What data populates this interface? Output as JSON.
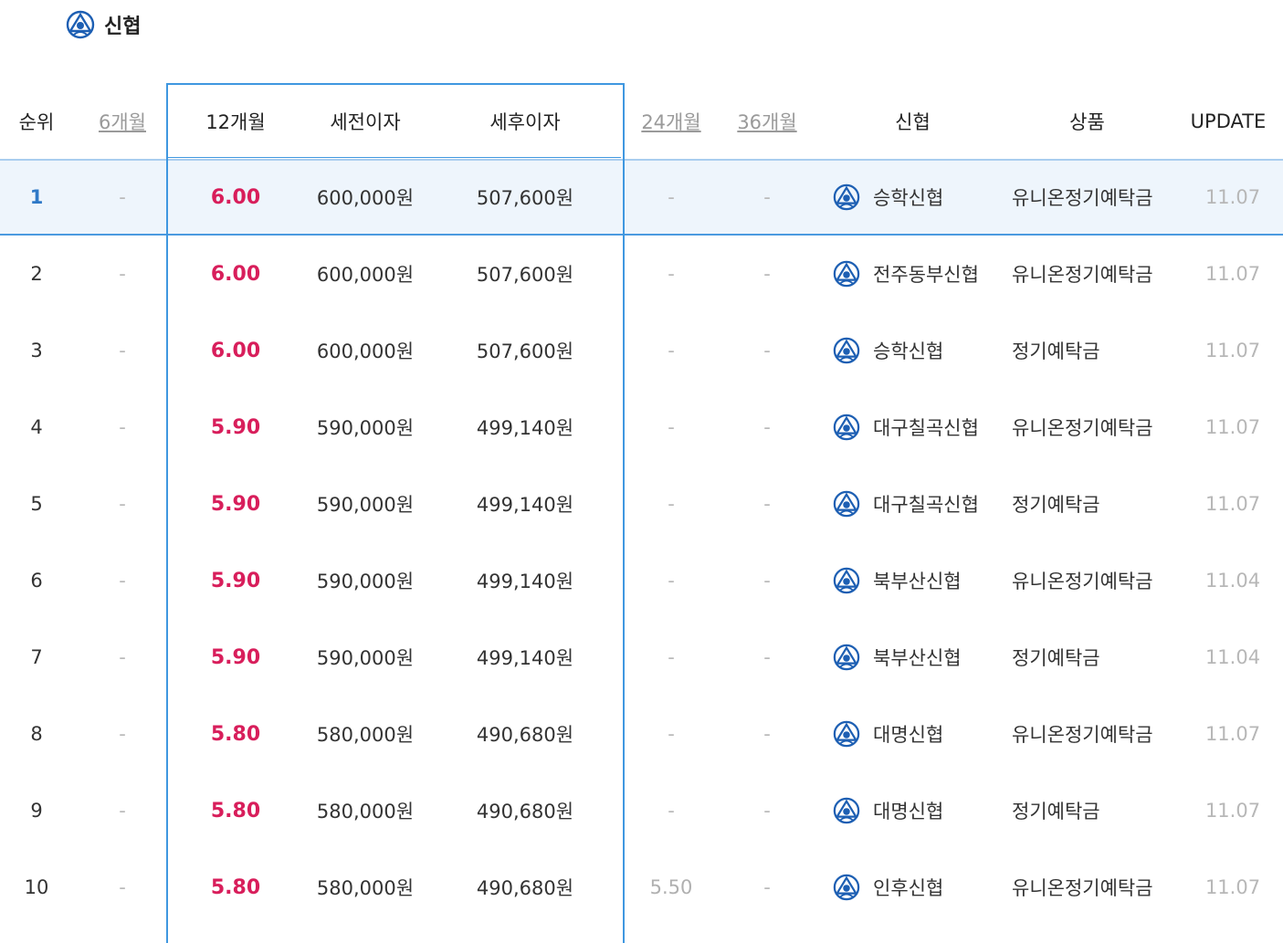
{
  "header": {
    "title": "신협",
    "logo_icon": "cu-logo-icon"
  },
  "columns": {
    "rank": "순위",
    "m6": "6개월",
    "m12": "12개월",
    "pre_tax": "세전이자",
    "post_tax": "세후이자",
    "m24": "24개월",
    "m36": "36개월",
    "bank": "신협",
    "product": "상품",
    "update": "UPDATE"
  },
  "colors": {
    "accent": "#3f97e0",
    "rate": "#d81e5b"
  },
  "rows": [
    {
      "rank": "1",
      "m6": "-",
      "m12": "6.00",
      "pre_tax": "600,000원",
      "post_tax": "507,600원",
      "m24": "-",
      "m36": "-",
      "bank": "승학신협",
      "product": "유니온정기예탁금",
      "update": "11.07"
    },
    {
      "rank": "2",
      "m6": "-",
      "m12": "6.00",
      "pre_tax": "600,000원",
      "post_tax": "507,600원",
      "m24": "-",
      "m36": "-",
      "bank": "전주동부신협",
      "product": "유니온정기예탁금",
      "update": "11.07"
    },
    {
      "rank": "3",
      "m6": "-",
      "m12": "6.00",
      "pre_tax": "600,000원",
      "post_tax": "507,600원",
      "m24": "-",
      "m36": "-",
      "bank": "승학신협",
      "product": "정기예탁금",
      "update": "11.07"
    },
    {
      "rank": "4",
      "m6": "-",
      "m12": "5.90",
      "pre_tax": "590,000원",
      "post_tax": "499,140원",
      "m24": "-",
      "m36": "-",
      "bank": "대구칠곡신협",
      "product": "유니온정기예탁금",
      "update": "11.07"
    },
    {
      "rank": "5",
      "m6": "-",
      "m12": "5.90",
      "pre_tax": "590,000원",
      "post_tax": "499,140원",
      "m24": "-",
      "m36": "-",
      "bank": "대구칠곡신협",
      "product": "정기예탁금",
      "update": "11.07"
    },
    {
      "rank": "6",
      "m6": "-",
      "m12": "5.90",
      "pre_tax": "590,000원",
      "post_tax": "499,140원",
      "m24": "-",
      "m36": "-",
      "bank": "북부산신협",
      "product": "유니온정기예탁금",
      "update": "11.04"
    },
    {
      "rank": "7",
      "m6": "-",
      "m12": "5.90",
      "pre_tax": "590,000원",
      "post_tax": "499,140원",
      "m24": "-",
      "m36": "-",
      "bank": "북부산신협",
      "product": "정기예탁금",
      "update": "11.04"
    },
    {
      "rank": "8",
      "m6": "-",
      "m12": "5.80",
      "pre_tax": "580,000원",
      "post_tax": "490,680원",
      "m24": "-",
      "m36": "-",
      "bank": "대명신협",
      "product": "유니온정기예탁금",
      "update": "11.07"
    },
    {
      "rank": "9",
      "m6": "-",
      "m12": "5.80",
      "pre_tax": "580,000원",
      "post_tax": "490,680원",
      "m24": "-",
      "m36": "-",
      "bank": "대명신협",
      "product": "정기예탁금",
      "update": "11.07"
    },
    {
      "rank": "10",
      "m6": "-",
      "m12": "5.80",
      "pre_tax": "580,000원",
      "post_tax": "490,680원",
      "m24": "5.50",
      "m36": "-",
      "bank": "인후신협",
      "product": "유니온정기예탁금",
      "update": "11.07"
    }
  ]
}
